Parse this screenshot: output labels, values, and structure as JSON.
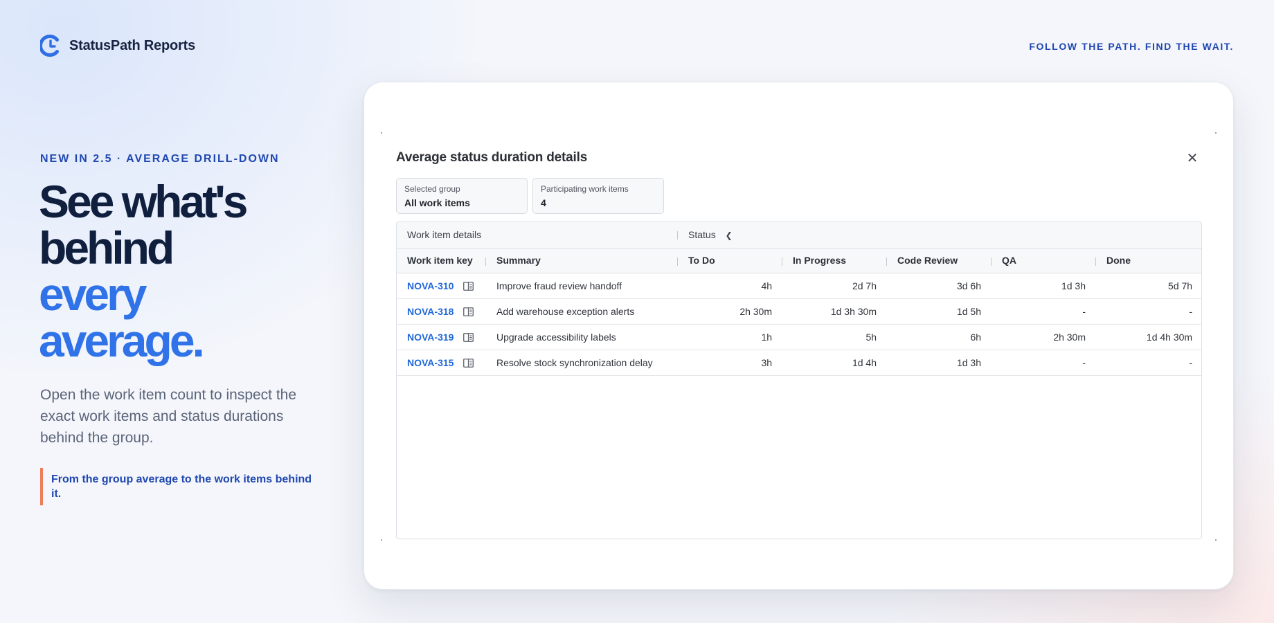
{
  "brand": {
    "name": "StatusPath Reports",
    "logo_icon": "clock-c-icon",
    "color": "#2f6fe3"
  },
  "tagline": "FOLLOW THE PATH. FIND THE WAIT.",
  "hero": {
    "eyebrow": "NEW IN 2.5 · AVERAGE DRILL-DOWN",
    "headline": [
      "See what's",
      "behind",
      "every",
      "average."
    ],
    "lead": "Open the work item count to inspect the exact work items and status durations behind the group.",
    "callout": "From the group average to the work items behind it."
  },
  "modal": {
    "title": "Average status duration details",
    "close_icon": "close-icon",
    "tiles": [
      {
        "label": "Selected group",
        "value": "All work items"
      },
      {
        "label": "Participating work items",
        "value": "4"
      }
    ],
    "table": {
      "group_headers": {
        "details": "Work item details",
        "status": "Status"
      },
      "columns": [
        "Work item key",
        "Summary",
        "To Do",
        "In Progress",
        "Code Review",
        "QA",
        "Done"
      ],
      "rows": [
        {
          "key": "NOVA-310",
          "summary": "Improve fraud review handoff",
          "todo": "4h",
          "in_progress": "2d 7h",
          "code_review": "3d 6h",
          "qa": "1d 3h",
          "done": "5d 7h"
        },
        {
          "key": "NOVA-318",
          "summary": "Add warehouse exception alerts",
          "todo": "2h 30m",
          "in_progress": "1d 3h 30m",
          "code_review": "1d 5h",
          "qa": "-",
          "done": "-"
        },
        {
          "key": "NOVA-319",
          "summary": "Upgrade accessibility labels",
          "todo": "1h",
          "in_progress": "5h",
          "code_review": "6h",
          "qa": "2h 30m",
          "done": "1d 4h 30m"
        },
        {
          "key": "NOVA-315",
          "summary": "Resolve stock synchronization delay",
          "todo": "3h",
          "in_progress": "1d 4h",
          "code_review": "1d 3h",
          "qa": "-",
          "done": "-"
        }
      ]
    }
  }
}
